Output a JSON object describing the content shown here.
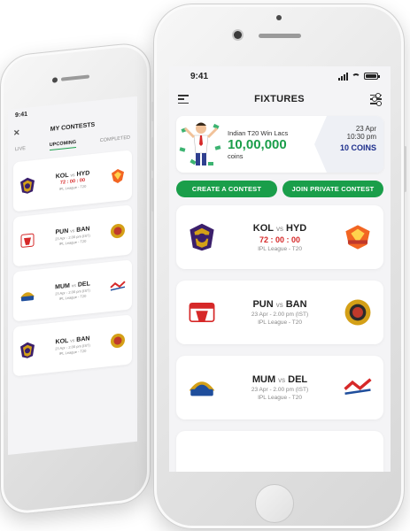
{
  "front": {
    "status_time": "9:41",
    "nav_title": "FIXTURES",
    "promo": {
      "name": "Indian T20 Win Lacs",
      "amount": "10,00,000",
      "unit": "coins",
      "date": "23 Apr",
      "time": "10:30 pm",
      "coins": "10 COINS"
    },
    "buttons": {
      "create": "CREATE A CONTEST",
      "join": "JOIN PRIVATE CONTEST"
    },
    "matches": [
      {
        "team1": "KOL",
        "vs": "vs",
        "team2": "HYD",
        "timer": "72 : 00 : 00",
        "date": "",
        "league": "IPL League - T20"
      },
      {
        "team1": "PUN",
        "vs": "vs",
        "team2": "BAN",
        "timer": "",
        "date": "23 Apr - 2.00 pm (IST)",
        "league": "IPL League - T20"
      },
      {
        "team1": "MUM",
        "vs": "vs",
        "team2": "DEL",
        "timer": "",
        "date": "23 Apr - 2.00 pm (IST)",
        "league": "IPL League - T20"
      }
    ]
  },
  "back": {
    "status_time": "9:41",
    "nav_title": "MY CONTESTS",
    "tabs": [
      "LIVE",
      "UPCOMING",
      "COMPLETED"
    ],
    "matches": [
      {
        "team1": "KOL",
        "vs": "vs",
        "team2": "HYD",
        "timer": "72 : 00 : 00",
        "date": "",
        "league": "IPL League - T20"
      },
      {
        "team1": "PUN",
        "vs": "vs",
        "team2": "BAN",
        "timer": "",
        "date": "23 Apr - 2.00 pm (IST)",
        "league": "IPL League - T20"
      },
      {
        "team1": "MUM",
        "vs": "vs",
        "team2": "DEL",
        "timer": "",
        "date": "23 Apr - 2.00 pm (IST)",
        "league": "IPL League - T20"
      },
      {
        "team1": "KOL",
        "vs": "vs",
        "team2": "BAN",
        "timer": "",
        "date": "23 Apr - 2.00 pm (IST)",
        "league": "IPL League - T20"
      }
    ]
  },
  "colors": {
    "accent_green": "#1a9e4a",
    "timer_red": "#d62828",
    "coins_navy": "#1c2e8c"
  },
  "icons": {
    "menu": "menu-icon",
    "filter": "filter-icon",
    "close": "close-icon"
  }
}
